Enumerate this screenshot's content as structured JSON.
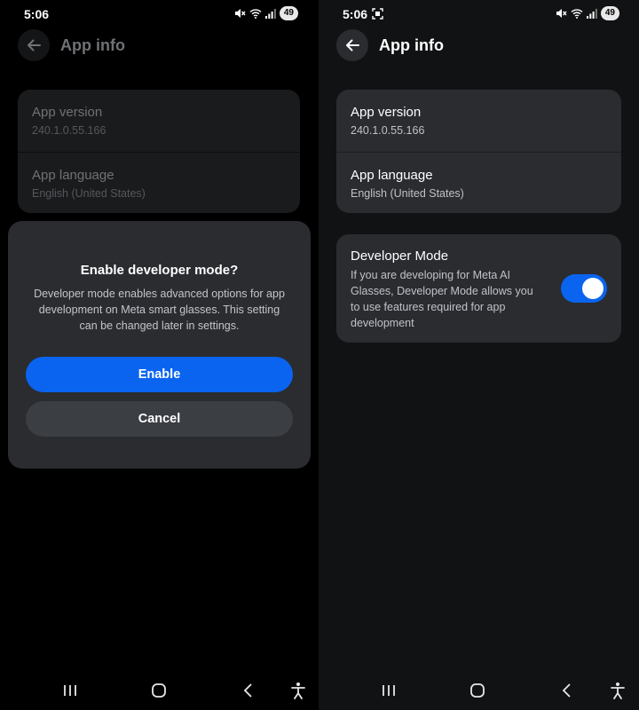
{
  "left": {
    "status": {
      "time": "5:06",
      "battery": "49"
    },
    "appbar": {
      "title": "App info"
    },
    "info": [
      {
        "label": "App version",
        "value": "240.1.0.55.166"
      },
      {
        "label": "App language",
        "value": "English (United States)"
      }
    ],
    "dialog": {
      "title": "Enable developer mode?",
      "body": "Developer mode enables advanced options for app development on Meta smart glasses. This setting can be changed later in settings.",
      "enable_label": "Enable",
      "cancel_label": "Cancel"
    }
  },
  "right": {
    "status": {
      "time": "5:06",
      "battery": "49"
    },
    "appbar": {
      "title": "App info"
    },
    "info": [
      {
        "label": "App version",
        "value": "240.1.0.55.166"
      },
      {
        "label": "App language",
        "value": "English (United States)"
      }
    ],
    "developer_mode": {
      "title": "Developer Mode",
      "description": "If you are developing for Meta AI Glasses, Developer Mode allows you to use features required for app development",
      "enabled": true
    }
  },
  "colors": {
    "accent": "#0a64f0",
    "card": "#2a2c30",
    "background": "#111213"
  }
}
